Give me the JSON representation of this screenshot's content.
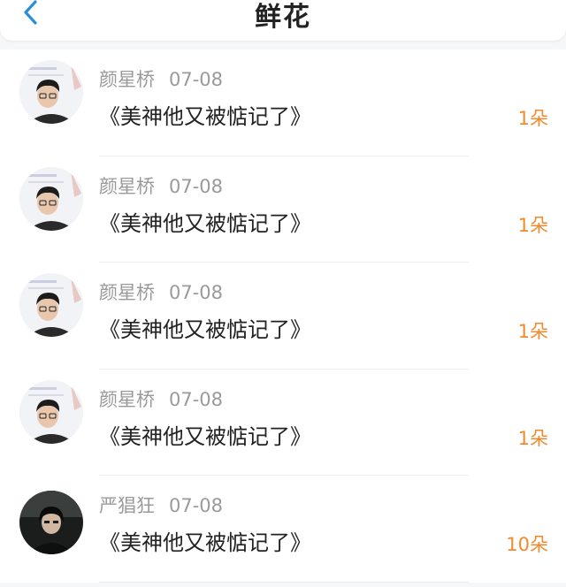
{
  "header": {
    "title": "鲜花"
  },
  "colors": {
    "accent_count": "#f08a2c",
    "back_arrow": "#2a8fd6",
    "name_gray": "#9a9a9a",
    "title_dark": "#222222"
  },
  "items": [
    {
      "user": "颜星桥",
      "date": "07-08",
      "book": "《美神他又被惦记了》",
      "count": "1朵",
      "avatar_icon": "avatar-icon"
    },
    {
      "user": "颜星桥",
      "date": "07-08",
      "book": "《美神他又被惦记了》",
      "count": "1朵",
      "avatar_icon": "avatar-icon"
    },
    {
      "user": "颜星桥",
      "date": "07-08",
      "book": "《美神他又被惦记了》",
      "count": "1朵",
      "avatar_icon": "avatar-icon"
    },
    {
      "user": "颜星桥",
      "date": "07-08",
      "book": "《美神他又被惦记了》",
      "count": "1朵",
      "avatar_icon": "avatar-icon"
    },
    {
      "user": "严猖狂",
      "date": "07-08",
      "book": "《美神他又被惦记了》",
      "count": "10朵",
      "avatar_icon": "avatar-icon"
    }
  ]
}
